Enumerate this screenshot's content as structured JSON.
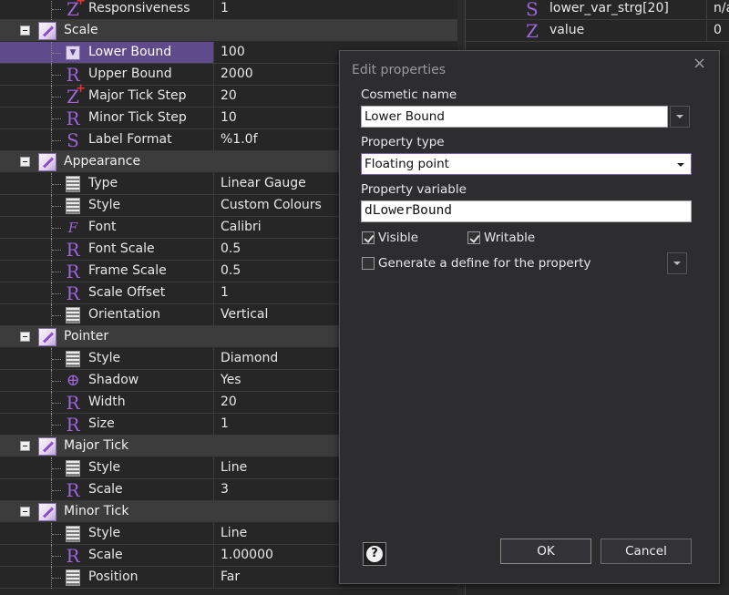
{
  "grid": {
    "rows": [
      {
        "kind": "prop",
        "icon": "Z+",
        "icon_name": "integer-plus-icon",
        "label": "Responsiveness",
        "value": "1"
      },
      {
        "kind": "cat",
        "label": "Scale"
      },
      {
        "kind": "prop",
        "icon": "▾",
        "icon_name": "dropdown-icon",
        "label": "Lower Bound",
        "value": "100",
        "selected": true
      },
      {
        "kind": "prop",
        "icon": "R",
        "icon_name": "real-icon",
        "label": "Upper Bound",
        "value": "2000"
      },
      {
        "kind": "prop",
        "icon": "Z+",
        "icon_name": "integer-plus-icon",
        "label": "Major Tick Step",
        "value": "20"
      },
      {
        "kind": "prop",
        "icon": "R",
        "icon_name": "real-icon",
        "label": "Minor Tick Step",
        "value": "10"
      },
      {
        "kind": "prop",
        "icon": "S",
        "icon_name": "string-icon",
        "label": "Label Format",
        "value": "%1.0f"
      },
      {
        "kind": "cat",
        "label": "Appearance"
      },
      {
        "kind": "prop",
        "icon": "list",
        "icon_name": "list-icon",
        "label": "Type",
        "value": "Linear Gauge"
      },
      {
        "kind": "prop",
        "icon": "list",
        "icon_name": "list-icon",
        "label": "Style",
        "value": "Custom Colours"
      },
      {
        "kind": "prop",
        "icon": "F",
        "icon_name": "font-icon",
        "label": "Font",
        "value": "Calibri"
      },
      {
        "kind": "prop",
        "icon": "R",
        "icon_name": "real-icon",
        "label": "Font Scale",
        "value": "0.5"
      },
      {
        "kind": "prop",
        "icon": "R",
        "icon_name": "real-icon",
        "label": "Frame Scale",
        "value": "0.5"
      },
      {
        "kind": "prop",
        "icon": "R",
        "icon_name": "real-icon",
        "label": "Scale Offset",
        "value": "1"
      },
      {
        "kind": "prop",
        "icon": "list",
        "icon_name": "list-icon",
        "label": "Orientation",
        "value": "Vertical"
      },
      {
        "kind": "cat",
        "label": "Pointer"
      },
      {
        "kind": "prop",
        "icon": "list",
        "icon_name": "list-icon",
        "label": "Style",
        "value": "Diamond"
      },
      {
        "kind": "prop",
        "icon": "⊕",
        "icon_name": "boolean-target-icon",
        "label": "Shadow",
        "value": "Yes"
      },
      {
        "kind": "prop",
        "icon": "R",
        "icon_name": "real-icon",
        "label": "Width",
        "value": "20"
      },
      {
        "kind": "prop",
        "icon": "R",
        "icon_name": "real-icon",
        "label": "Size",
        "value": "1"
      },
      {
        "kind": "cat",
        "label": "Major Tick"
      },
      {
        "kind": "prop",
        "icon": "list",
        "icon_name": "list-icon",
        "label": "Style",
        "value": "Line"
      },
      {
        "kind": "prop",
        "icon": "R",
        "icon_name": "real-icon",
        "label": "Scale",
        "value": "3"
      },
      {
        "kind": "cat",
        "label": "Minor Tick"
      },
      {
        "kind": "prop",
        "icon": "list",
        "icon_name": "list-icon",
        "label": "Style",
        "value": "Line"
      },
      {
        "kind": "prop",
        "icon": "R",
        "icon_name": "real-icon",
        "label": "Scale",
        "value": "1.00000"
      },
      {
        "kind": "prop",
        "icon": "list",
        "icon_name": "list-icon",
        "label": "Position",
        "value": "Far"
      }
    ]
  },
  "right": {
    "rows": [
      {
        "icon": "S",
        "icon_name": "string-icon",
        "label": "lower_var_strg[20]",
        "value": "n/a"
      },
      {
        "icon": "Z",
        "icon_name": "integer-icon",
        "label": "value",
        "value": "0"
      }
    ]
  },
  "dialog": {
    "title": "Edit properties",
    "cosmetic_name_label": "Cosmetic name",
    "cosmetic_name_value": "Lower Bound",
    "property_type_label": "Property type",
    "property_type_value": "Floating point",
    "property_variable_label": "Property variable",
    "property_variable_value": "dLowerBound",
    "visible_label": "Visible",
    "visible_checked": true,
    "writable_label": "Writable",
    "writable_checked": true,
    "define_label": "Generate a define for the property",
    "define_checked": false,
    "help_symbol": "?",
    "ok_label": "OK",
    "cancel_label": "Cancel",
    "close_symbol": "×"
  },
  "colors": {
    "accent": "#9b66d6",
    "selection": "#5f4b8b",
    "dialog_bg": "#2d2d30"
  }
}
